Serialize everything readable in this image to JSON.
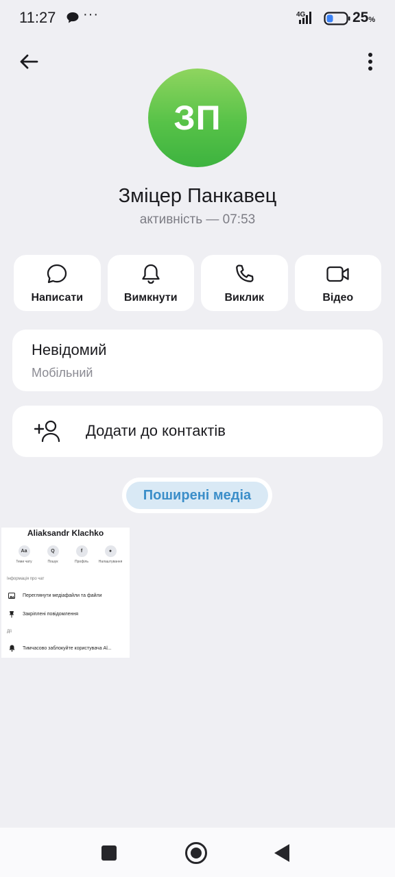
{
  "status_bar": {
    "time": "11:27",
    "dots": "···",
    "network": "4G",
    "battery": "25",
    "battery_unit": "%"
  },
  "header": {
    "back_icon": "arrow-left-icon",
    "menu_icon": "more-vertical-icon"
  },
  "profile": {
    "initials": "ЗП",
    "name": "Зміцер Панкавец",
    "status": "активність — 07:53",
    "avatar_colors": [
      "#8fd55f",
      "#3db33f"
    ]
  },
  "actions": [
    {
      "label": "Написати",
      "icon": "message-bubble-icon"
    },
    {
      "label": "Вимкнути",
      "icon": "bell-icon"
    },
    {
      "label": "Виклик",
      "icon": "phone-icon"
    },
    {
      "label": "Відео",
      "icon": "video-camera-icon"
    }
  ],
  "phone": {
    "number": "Невідомий",
    "type": "Мобільний"
  },
  "add_contact": {
    "label": "Додати до контактів",
    "icon": "add-person-icon"
  },
  "media": {
    "tab_label": "Поширені медіа",
    "accent": "#3b8ec9",
    "thumbnail": {
      "title": "Aliaksandr Klachko",
      "actions": [
        {
          "symbol": "Aa",
          "label": "Теми чату"
        },
        {
          "symbol": "Q",
          "label": "Пошук"
        },
        {
          "symbol": "f",
          "label": "Профіль"
        },
        {
          "symbol": "●",
          "label": "Налаштування"
        }
      ],
      "section_info": "Інформація про чат",
      "item_media": "Переглянути медіафайли та файли",
      "item_pinned": "Закріплені повідомлення",
      "section_actions": "Дії",
      "item_block": "Тимчасово заблокуйте користувача Al..."
    }
  },
  "nav_bar": {
    "recents_icon": "square-icon",
    "home_icon": "circle-home-icon",
    "back_icon": "triangle-back-icon"
  }
}
